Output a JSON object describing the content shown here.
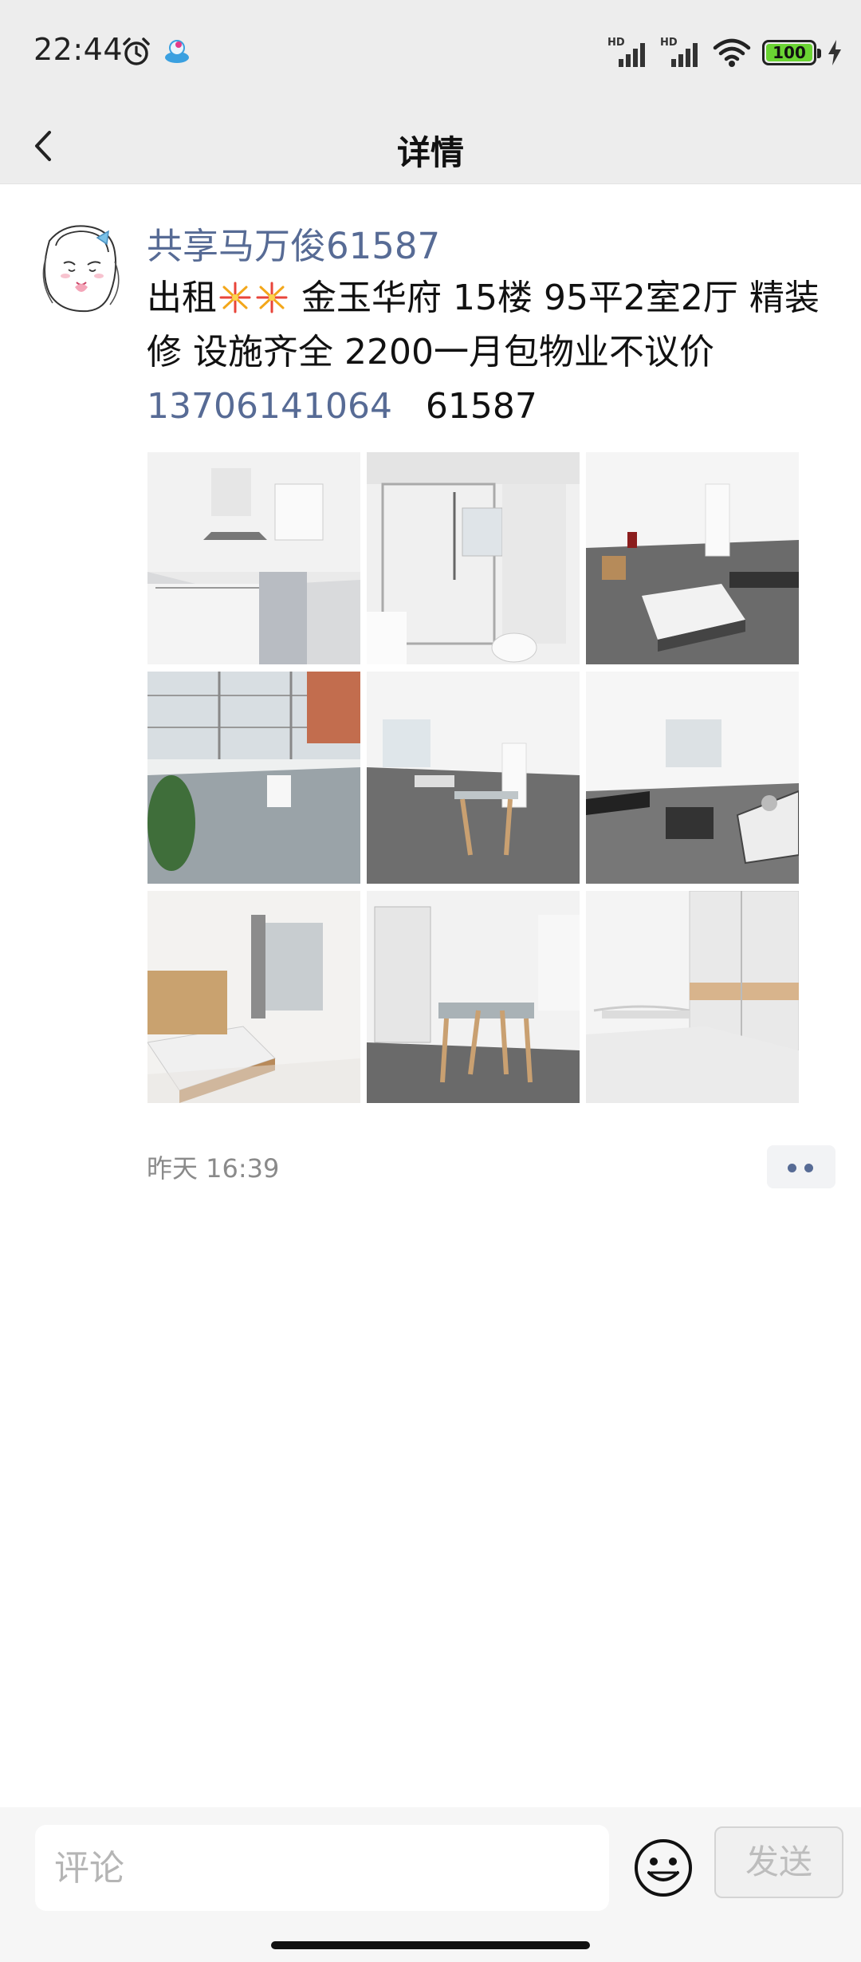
{
  "status_bar": {
    "time": "22:44",
    "battery": "100",
    "signal1_label": "HD",
    "signal2_label": "HD"
  },
  "header": {
    "title": "详情"
  },
  "post": {
    "author": "共享马万俊61587",
    "text_prefix": "出租",
    "text_body": " 金玉华府 15楼 95平2室2厅 精装修 设施齐全 2200一月包物业不议价",
    "phone": "13706141064",
    "code": "61587",
    "timestamp": "昨天 16:39",
    "photos": [
      {
        "name": "kitchen",
        "bg": "#d9dadc"
      },
      {
        "name": "bathroom",
        "bg": "#d2d4d6"
      },
      {
        "name": "living-room-1",
        "bg": "#bfbfbf"
      },
      {
        "name": "balcony",
        "bg": "#c9ced0"
      },
      {
        "name": "living-dining",
        "bg": "#bdbdbd"
      },
      {
        "name": "living-room-2",
        "bg": "#c4c4c4"
      },
      {
        "name": "bedroom-1",
        "bg": "#d8d6d2"
      },
      {
        "name": "dining-room",
        "bg": "#bdbdbb"
      },
      {
        "name": "bedroom-2",
        "bg": "#dedede"
      }
    ]
  },
  "comment_bar": {
    "placeholder": "评论",
    "send_label": "发送"
  },
  "colors": {
    "link": "#576b95",
    "bar_bg": "#ededed",
    "battery_fill": "#6ad433"
  }
}
